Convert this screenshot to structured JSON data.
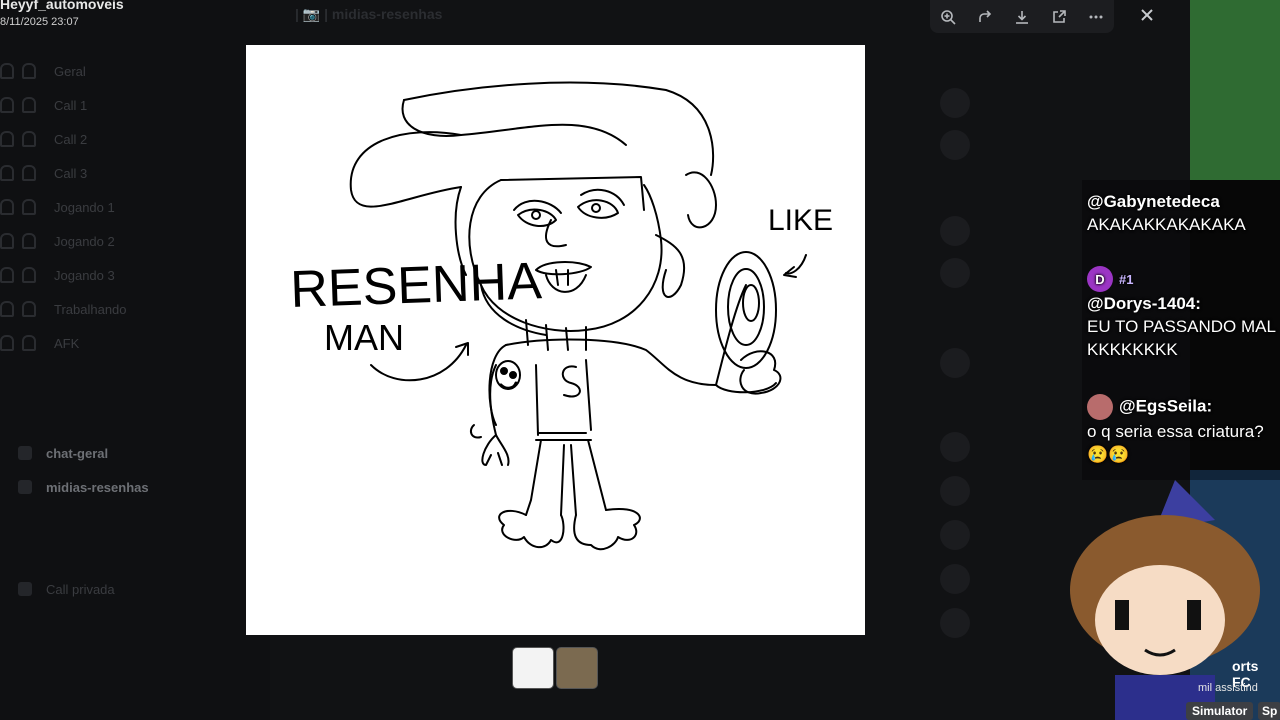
{
  "stream": {
    "streamer_name": "Heyyf_automoveis",
    "timestamp": "8/11/2025 23:07"
  },
  "discord": {
    "channel_title": "| 📷 | midias-resenhas",
    "channels": [
      {
        "label": "Geral"
      },
      {
        "label": "Call 1"
      },
      {
        "label": "Call 2"
      },
      {
        "label": "Call 3"
      },
      {
        "label": "Jogando 1"
      },
      {
        "label": "Jogando 2"
      },
      {
        "label": "Jogando 3"
      },
      {
        "label": "Trabalhando"
      },
      {
        "label": "AFK"
      },
      {
        "label": "chat-geral"
      },
      {
        "label": "midias-resenhas"
      },
      {
        "label": "Call privada"
      }
    ]
  },
  "viewer_toolbar": {
    "icons": [
      "zoom-in-icon",
      "forward-icon",
      "download-icon",
      "open-external-icon",
      "more-icon"
    ],
    "close_icon": "close-icon"
  },
  "drawing": {
    "text_left": "RESENHA",
    "text_left2": "MAN",
    "text_right": "LIKE",
    "shirt_letter": "S"
  },
  "chat": {
    "messages": [
      {
        "author": "@Gabynetedeca",
        "text": "AKAKAKKAKAKAKA"
      },
      {
        "badge": "D",
        "author": "@Dorys-1404:",
        "text": "EU TO PASSANDO MAL KKKKKKKK"
      },
      {
        "author": "@EgsSeila:",
        "text": "o q seria essa criatura?😢😢"
      }
    ],
    "crown_text": "#1"
  },
  "stream_right": {
    "fc_label": "orts FC",
    "viewers": "mil assistind",
    "sim_label": "Simulator",
    "sim_label2": "Sp"
  },
  "colors": {
    "overlay_bg": "#111214",
    "toolbar_bg": "#1c1d20",
    "canvas_bg": "#ffffff",
    "badge_purple": "#9b35c4"
  }
}
